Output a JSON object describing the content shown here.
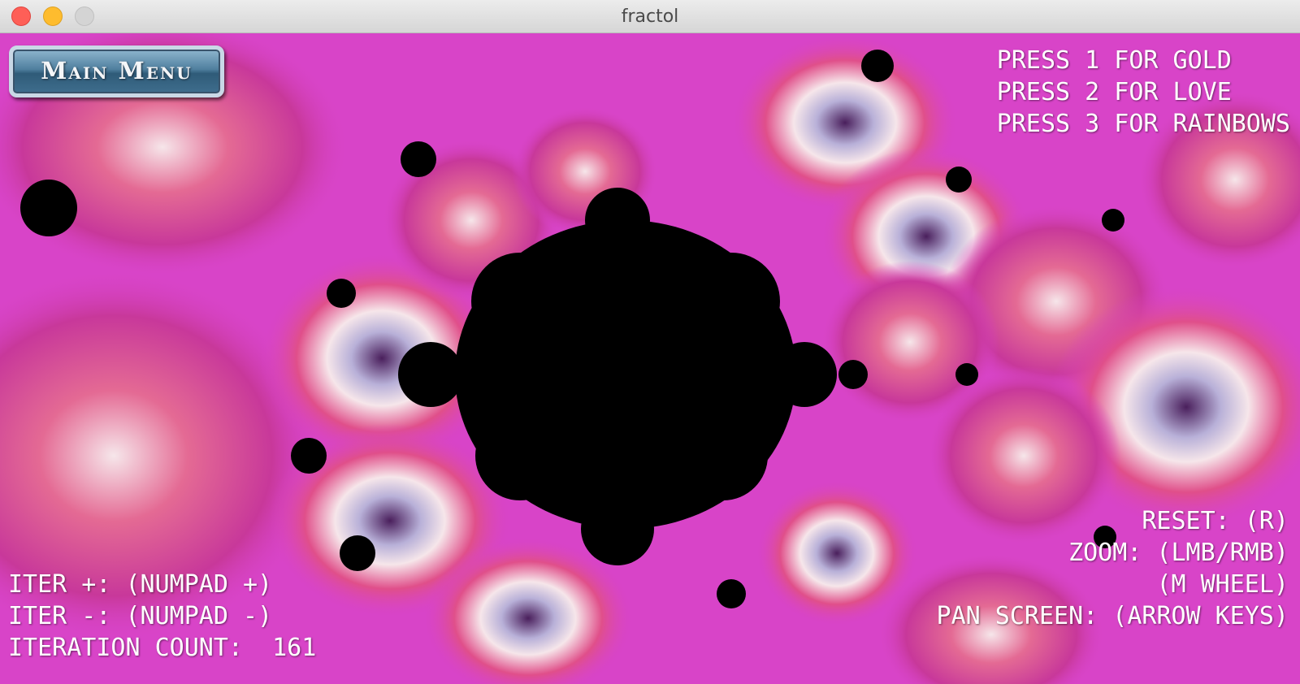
{
  "window": {
    "title": "fractol"
  },
  "main_menu": {
    "label": "Main Menu"
  },
  "color_hints": [
    "PRESS 1 FOR GOLD",
    "PRESS 2 FOR LOVE",
    "PRESS 3 FOR RAINBOWS"
  ],
  "controls_right": [
    "RESET: (R)",
    "ZOOM: (LMB/RMB)",
    "(M WHEEL)",
    "PAN SCREEN: (ARROW KEYS)"
  ],
  "controls_left": [
    "ITER +: (NUMPAD +)",
    "ITER -: (NUMPAD -)",
    "ITERATION COUNT:  161"
  ],
  "palette": {
    "magenta": "#d844c8",
    "pink": "#e04f8a",
    "cream": "#f6e6ea",
    "purple": "#4a1f5c",
    "black": "#000000"
  }
}
